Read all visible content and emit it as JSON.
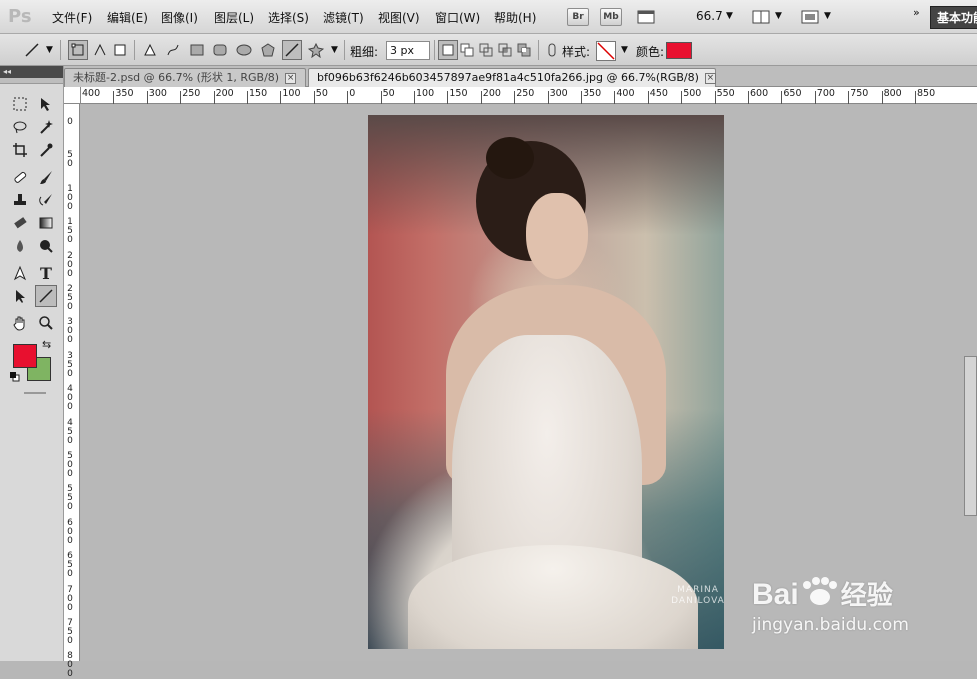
{
  "app": {
    "logo": "Ps"
  },
  "menu": [
    "文件(F)",
    "编辑(E)",
    "图像(I)",
    "图层(L)",
    "选择(S)",
    "滤镜(T)",
    "视图(V)",
    "窗口(W)",
    "帮助(H)"
  ],
  "menubar_buttons": {
    "bridge": "Br",
    "minibridge": "Mb",
    "zoom": "66.7",
    "workspace": "基本功能"
  },
  "options": {
    "weight_label": "粗细:",
    "weight_value": "3 px",
    "style_label": "样式:",
    "color_label": "颜色:",
    "color_value": "#e8102f"
  },
  "tabs": [
    {
      "label": "未标题-2.psd @ 66.7% (形状 1, RGB/8)",
      "close": "×"
    },
    {
      "label": "bf096b63f6246b603457897ae9f81a4c510fa266.jpg @ 66.7%(RGB/8)",
      "close": "×"
    }
  ],
  "ruler_h": [
    "400",
    "350",
    "300",
    "250",
    "200",
    "150",
    "100",
    "50",
    "0",
    "50",
    "100",
    "150",
    "200",
    "250",
    "300",
    "350",
    "400",
    "450",
    "500",
    "550",
    "600",
    "650",
    "700",
    "750",
    "800",
    "850"
  ],
  "ruler_v": [
    "0",
    "50",
    "100",
    "150",
    "200",
    "250",
    "300",
    "350",
    "400",
    "450",
    "500",
    "550",
    "600",
    "650",
    "700",
    "750",
    "800"
  ],
  "colors": {
    "foreground": "#e8102f",
    "background": "#7fb462"
  },
  "image_watermark": {
    "line1": "MARINA",
    "line2": "DANILOVA"
  },
  "baidu": {
    "logo": "Bai",
    "logo2": "经验",
    "url": "jingyan.baidu.com"
  }
}
